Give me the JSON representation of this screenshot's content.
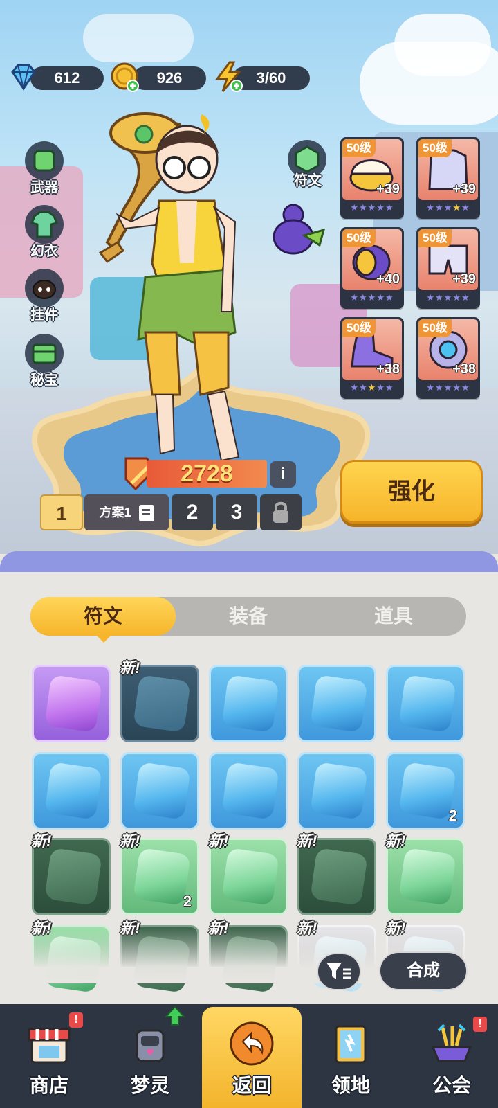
{
  "currency": {
    "diamonds": "612",
    "coins": "926",
    "stamina": "3/60"
  },
  "side_menu": [
    {
      "label": "武器"
    },
    {
      "label": "幻衣"
    },
    {
      "label": "挂件"
    },
    {
      "label": "秘宝"
    }
  ],
  "rune_button": {
    "label": "符文"
  },
  "equipment": [
    {
      "level": "50级",
      "bonus": "+39",
      "stars": "★★★★★",
      "gold_star_index": null
    },
    {
      "level": "50级",
      "bonus": "+39",
      "stars": "★★★★★",
      "gold_star_index": 3
    },
    {
      "level": "50级",
      "bonus": "+40",
      "stars": "★★★★★",
      "gold_star_index": null
    },
    {
      "level": "50级",
      "bonus": "+39",
      "stars": "★★★★★",
      "gold_star_index": null
    },
    {
      "level": "50级",
      "bonus": "+38",
      "stars": "★★★★★",
      "gold_star_index": 2
    },
    {
      "level": "50级",
      "bonus": "+38",
      "stars": "★★★★★",
      "gold_star_index": null
    }
  ],
  "power": {
    "value": "2728",
    "info_icon": "i"
  },
  "plans": {
    "slot1": "1",
    "name": "方案1",
    "slot2": "2",
    "slot3": "3"
  },
  "enhance_button": "强化",
  "tabs": [
    {
      "label": "符文",
      "active": true
    },
    {
      "label": "装备",
      "active": false
    },
    {
      "label": "道具",
      "active": false
    }
  ],
  "inventory": {
    "new_label": "新!",
    "rows": [
      [
        {
          "color": "purple",
          "new": false,
          "count": ""
        },
        {
          "color": "dblue",
          "new": true,
          "count": ""
        },
        {
          "color": "blue",
          "new": false,
          "count": ""
        },
        {
          "color": "blue",
          "new": false,
          "count": ""
        },
        {
          "color": "blue",
          "new": false,
          "count": ""
        }
      ],
      [
        {
          "color": "blue",
          "new": false,
          "count": ""
        },
        {
          "color": "blue",
          "new": false,
          "count": ""
        },
        {
          "color": "blue",
          "new": false,
          "count": ""
        },
        {
          "color": "blue",
          "new": false,
          "count": ""
        },
        {
          "color": "blue",
          "new": false,
          "count": "2"
        }
      ],
      [
        {
          "color": "dgreen",
          "new": true,
          "count": ""
        },
        {
          "color": "green",
          "new": true,
          "count": "2"
        },
        {
          "color": "green",
          "new": true,
          "count": ""
        },
        {
          "color": "dgreen",
          "new": true,
          "count": ""
        },
        {
          "color": "green",
          "new": true,
          "count": ""
        }
      ],
      [
        {
          "color": "green",
          "new": true,
          "count": ""
        },
        {
          "color": "dgreen",
          "new": true,
          "count": ""
        },
        {
          "color": "dgreen",
          "new": true,
          "count": ""
        },
        {
          "color": "grey",
          "new": true,
          "count": ""
        },
        {
          "color": "grey",
          "new": true,
          "count": ""
        }
      ]
    ]
  },
  "merge_button": "合成",
  "nav": [
    {
      "label": "商店",
      "badge": "!"
    },
    {
      "label": "梦灵",
      "badge": ""
    },
    {
      "label": "返回",
      "badge": ""
    },
    {
      "label": "领地",
      "badge": ""
    },
    {
      "label": "公会",
      "badge": "!"
    }
  ]
}
